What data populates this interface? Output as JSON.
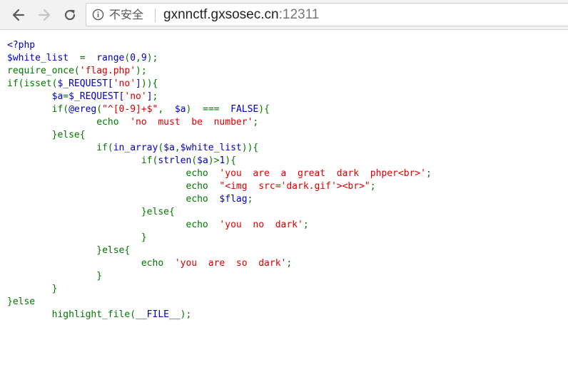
{
  "browser": {
    "back_icon": "arrow-left-icon",
    "forward_icon": "arrow-right-icon",
    "reload_icon": "reload-icon",
    "security_icon": "info-circle-icon",
    "security_label": "不安全",
    "url_host": "gxnnctf.gxsosec.cn",
    "url_port": ":12311"
  },
  "source": {
    "lines": [
      "<?php",
      "$white_list  =  range(0,9);",
      "require_once('flag.php');",
      "if(isset($_REQUEST['no'])){",
      "        $a=$_REQUEST['no'];",
      "        if(@ereg(\"^[0-9]+$\",  $a)  ===  FALSE){",
      "                echo  'no  must  be  number';",
      "        }else{",
      "                if(in_array($a,$white_list)){",
      "                        if(strlen($a)>1){",
      "                                echo  'you  are  a  great  dark  phper<br>';",
      "                                echo  \"<img  src='dark.gif'><br>\";",
      "                                echo  $flag;",
      "                        }else{",
      "                                echo  'you  no  dark';",
      "                        }",
      "                }else{",
      "                        echo  'you  are  so  dark';",
      "                }",
      "        }",
      "}else",
      "        highlight_file(__FILE__);"
    ]
  },
  "colors": {
    "html": "#0000BB",
    "keyword": "#007700",
    "string": "#DD0000",
    "toolbar_bg": "#f2f2f2"
  }
}
